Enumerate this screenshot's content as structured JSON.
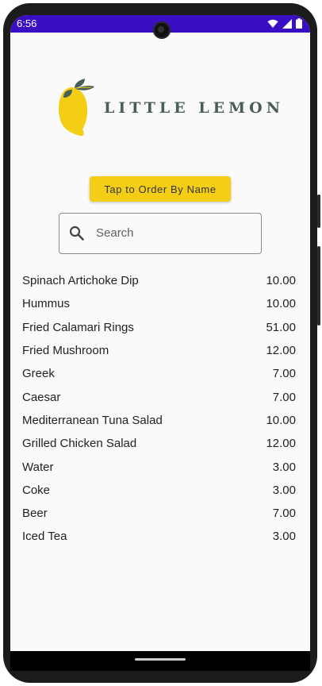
{
  "status_bar": {
    "time": "6:56",
    "icons": [
      "wifi-icon",
      "signal-icon",
      "battery-icon"
    ],
    "background_color": "#3a0ec2"
  },
  "header": {
    "logo_text": "LITTLE LEMON",
    "logo_icon": "lemon-icon",
    "brand_color": "#495e57",
    "lemon_color": "#f4ce14"
  },
  "order_button": {
    "label": "Tap to Order By Name",
    "color": "#f4ce14"
  },
  "search": {
    "placeholder": "Search",
    "value": "",
    "icon": "search-icon"
  },
  "menu": {
    "items": [
      {
        "name": "Spinach Artichoke Dip",
        "price": "10.00"
      },
      {
        "name": "Hummus",
        "price": "10.00"
      },
      {
        "name": "Fried Calamari Rings",
        "price": "51.00"
      },
      {
        "name": "Fried Mushroom",
        "price": "12.00"
      },
      {
        "name": "Greek",
        "price": "7.00"
      },
      {
        "name": "Caesar",
        "price": "7.00"
      },
      {
        "name": "Mediterranean Tuna Salad",
        "price": "10.00"
      },
      {
        "name": "Grilled Chicken Salad",
        "price": "12.00"
      },
      {
        "name": "Water",
        "price": "3.00"
      },
      {
        "name": "Coke",
        "price": "3.00"
      },
      {
        "name": "Beer",
        "price": "7.00"
      },
      {
        "name": "Iced Tea",
        "price": "3.00"
      }
    ]
  }
}
